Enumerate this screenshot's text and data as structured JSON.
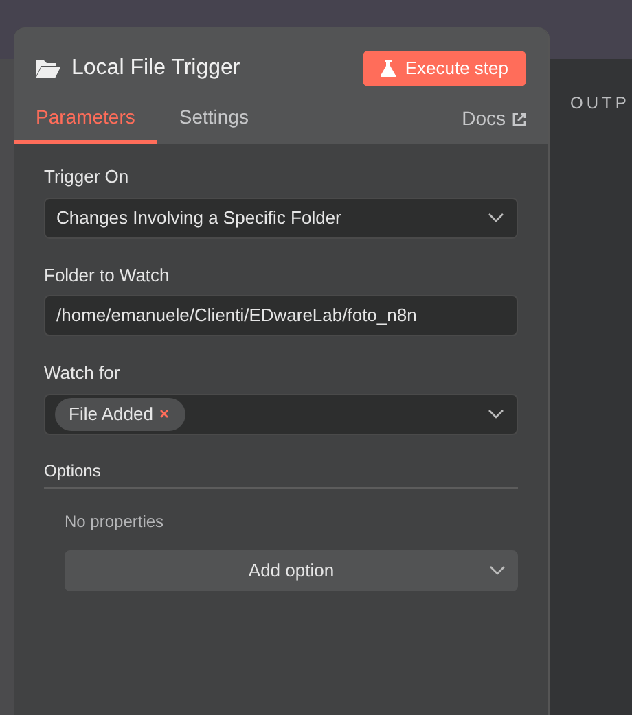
{
  "panel": {
    "title": "Local File Trigger",
    "execute_button": "Execute step",
    "tabs": [
      {
        "label": "Parameters",
        "selected": true
      },
      {
        "label": "Settings",
        "selected": false
      }
    ],
    "docs_link": "Docs"
  },
  "parameters": [
    {
      "kind": "select",
      "label": "Trigger On",
      "value": "Changes Involving a Specific Folder"
    },
    {
      "kind": "text",
      "label": "Folder to Watch",
      "value": "/home/emanuele/Clienti/EDwareLab/foto_n8n"
    },
    {
      "kind": "multiselect",
      "label": "Watch for",
      "chips": [
        "File Added"
      ]
    }
  ],
  "options": {
    "title": "Options",
    "empty_text": "No properties",
    "add_button": "Add option"
  },
  "output_panel": {
    "title": "OUTP"
  }
}
